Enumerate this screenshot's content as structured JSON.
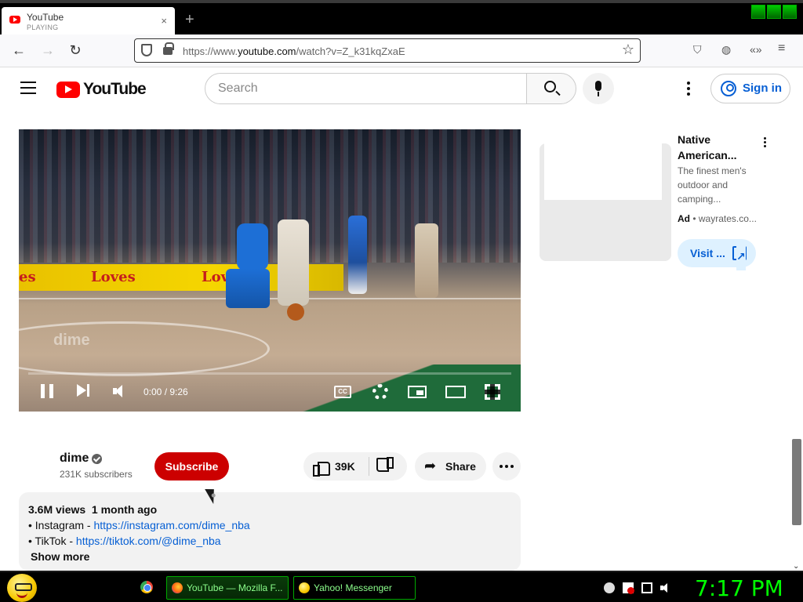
{
  "browser": {
    "tab": {
      "title": "YouTube",
      "subtitle": "PLAYING",
      "close": "×"
    },
    "new_tab": "+",
    "url_prefix": "https://www.",
    "url_domain": "youtube.com",
    "url_path": "/watch?v=Z_k31kqZxaE"
  },
  "youtube": {
    "logo_text": "YouTube",
    "search": {
      "placeholder": "Search"
    },
    "sign_in": "Sign in"
  },
  "video": {
    "banner_texts": [
      "es",
      "Loves",
      "Loves"
    ],
    "watermark": "dime",
    "time": "0:00 / 9:26",
    "cc": "CC",
    "progress": 0.0
  },
  "ad": {
    "title": "Native American...",
    "description": "The finest men's outdoor and camping...",
    "label": "Ad",
    "domain": "wayrates.co...",
    "visit": "Visit ..."
  },
  "channel": {
    "name": "dime",
    "subscribers": "231K subscribers",
    "subscribe": "Subscribe"
  },
  "actions": {
    "likes": "39K",
    "share": "Share"
  },
  "description": {
    "stats": "3.6M views  1 month ago",
    "instagram_prefix": "• Instagram - ",
    "instagram_link": "https://instagram.com/dime_nba",
    "tiktok_prefix": "• TikTok - ",
    "tiktok_link": "https://tiktok.com/@dime_nba",
    "show_more": "Show more"
  },
  "taskbar": {
    "tasks": [
      "YouTube — Mozilla F...",
      "Yahoo! Messenger"
    ],
    "clock": "7:17 PM"
  },
  "colors": {
    "brand_red": "#ff0000",
    "subscribe_red": "#cc0000",
    "link_blue": "#065fd4",
    "taskbar_green": "#00ff00"
  }
}
